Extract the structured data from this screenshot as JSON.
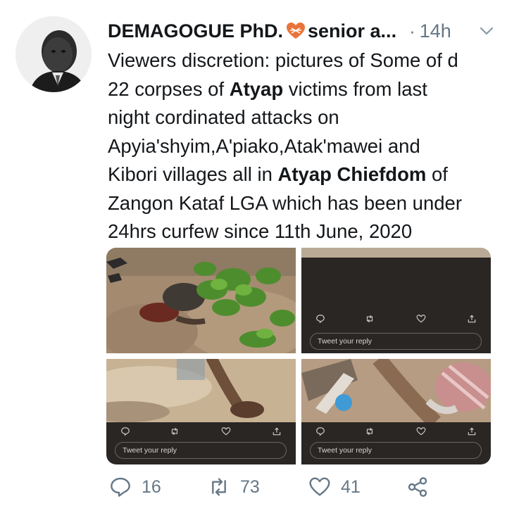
{
  "tweet": {
    "display_name": "DEMAGOGUE PhD.",
    "name_suffix": "senior a...",
    "separator": "·",
    "time": "14h",
    "text_lines": [
      [
        {
          "t": "Viewers discretion: pictures of Some of d",
          "b": false
        }
      ],
      [
        {
          "t": "22 corpses of ",
          "b": false
        },
        {
          "t": "Atyap",
          "b": true
        },
        {
          "t": " victims from last",
          "b": false
        }
      ],
      [
        {
          "t": "night cordinated attacks on",
          "b": false
        }
      ],
      [
        {
          "t": "Apyia'shyim,A'piako,Atak'mawei and",
          "b": false
        }
      ],
      [
        {
          "t": "Kibori villages all in ",
          "b": false
        },
        {
          "t": "Atyap Chiefdom",
          "b": true
        },
        {
          "t": " of",
          "b": false
        }
      ],
      [
        {
          "t": "Zangon Kataf LGA which has been under",
          "b": false
        }
      ],
      [
        {
          "t": "24hrs curfew since 11th June, 2020",
          "b": false
        }
      ]
    ]
  },
  "embedded": {
    "reply_placeholder": "Tweet your reply"
  },
  "actions": {
    "reply_count": "16",
    "retweet_count": "73",
    "like_count": "41"
  },
  "colors": {
    "text": "#14171a",
    "muted": "#657786",
    "heart_accent": "#e8743b",
    "dark_panel": "#2a2624"
  },
  "icons": [
    "heart-emoji-icon",
    "chevron-down-icon",
    "reply-icon",
    "retweet-icon",
    "like-icon",
    "share-icon"
  ]
}
